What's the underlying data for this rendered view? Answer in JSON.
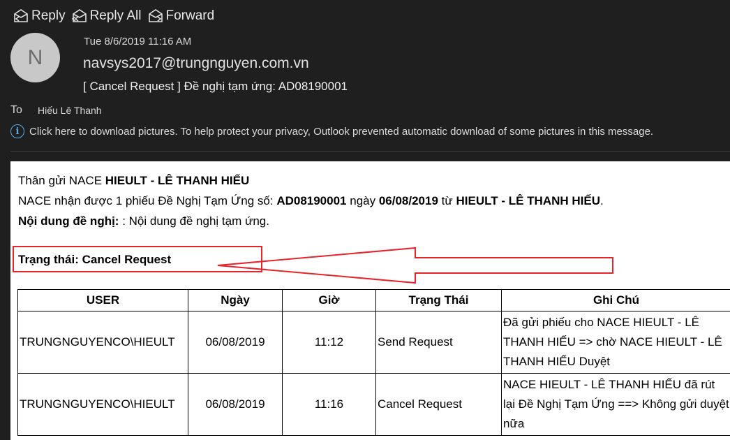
{
  "toolbar": {
    "reply": "Reply",
    "reply_all": "Reply All",
    "forward": "Forward"
  },
  "header": {
    "avatar_initial": "N",
    "date": "Tue 8/6/2019 11:16 AM",
    "sender": "navsys2017@trungnguyen.com.vn",
    "subject": "[ Cancel Request ] Đề nghị tạm ứng: AD08190001",
    "to_label": "To",
    "to_value": "Hiếu Lê Thanh",
    "info_text": "Click here to download pictures. To help protect your privacy, Outlook prevented automatic download of some pictures in this message."
  },
  "message": {
    "greeting_prefix": "Thân gửi NACE ",
    "greeting_name": "HIEULT - LÊ THANH HIẾU",
    "received_prefix": "NACE nhận được 1 phiếu Đề Nghị Tạm Ứng số: ",
    "doc_no": "AD08190001",
    "date_word": " ngày ",
    "doc_date": "06/08/2019",
    "from_word": " từ ",
    "from_name": "HIEULT - LÊ THANH HIẾU",
    "period": ".",
    "content_label": "Nội dung đề nghị:",
    "content_value": " : Nội dung đề nghị tạm ứng.",
    "status": "Trạng thái: Cancel Request"
  },
  "table": {
    "headers": [
      "USER",
      "Ngày",
      "Giờ",
      "Trạng Thái",
      "Ghi Chú"
    ],
    "rows": [
      {
        "user": "TRUNGNGUYENCO\\HIEULT",
        "date": "06/08/2019",
        "time": "11:12",
        "status": "Send Request",
        "note": "Đã gửi phiếu cho NACE HIEULT - LÊ THANH HIẾU => chờ NACE HIEULT - LÊ THANH HIẾU Duyệt"
      },
      {
        "user": "TRUNGNGUYENCO\\HIEULT",
        "date": "06/08/2019",
        "time": "11:16",
        "status": "Cancel Request",
        "note": "NACE HIEULT - LÊ THANH HIẾU đã rút lại Đề Nghị Tạm Ứng ==> Không gửi duyệt nữa"
      }
    ]
  },
  "colors": {
    "background": "#1f1f1f",
    "annotation_red": "#e5242b",
    "info_blue": "#5aa9e6"
  },
  "icons": [
    "reply-icon",
    "reply-all-icon",
    "forward-icon",
    "info-icon"
  ]
}
